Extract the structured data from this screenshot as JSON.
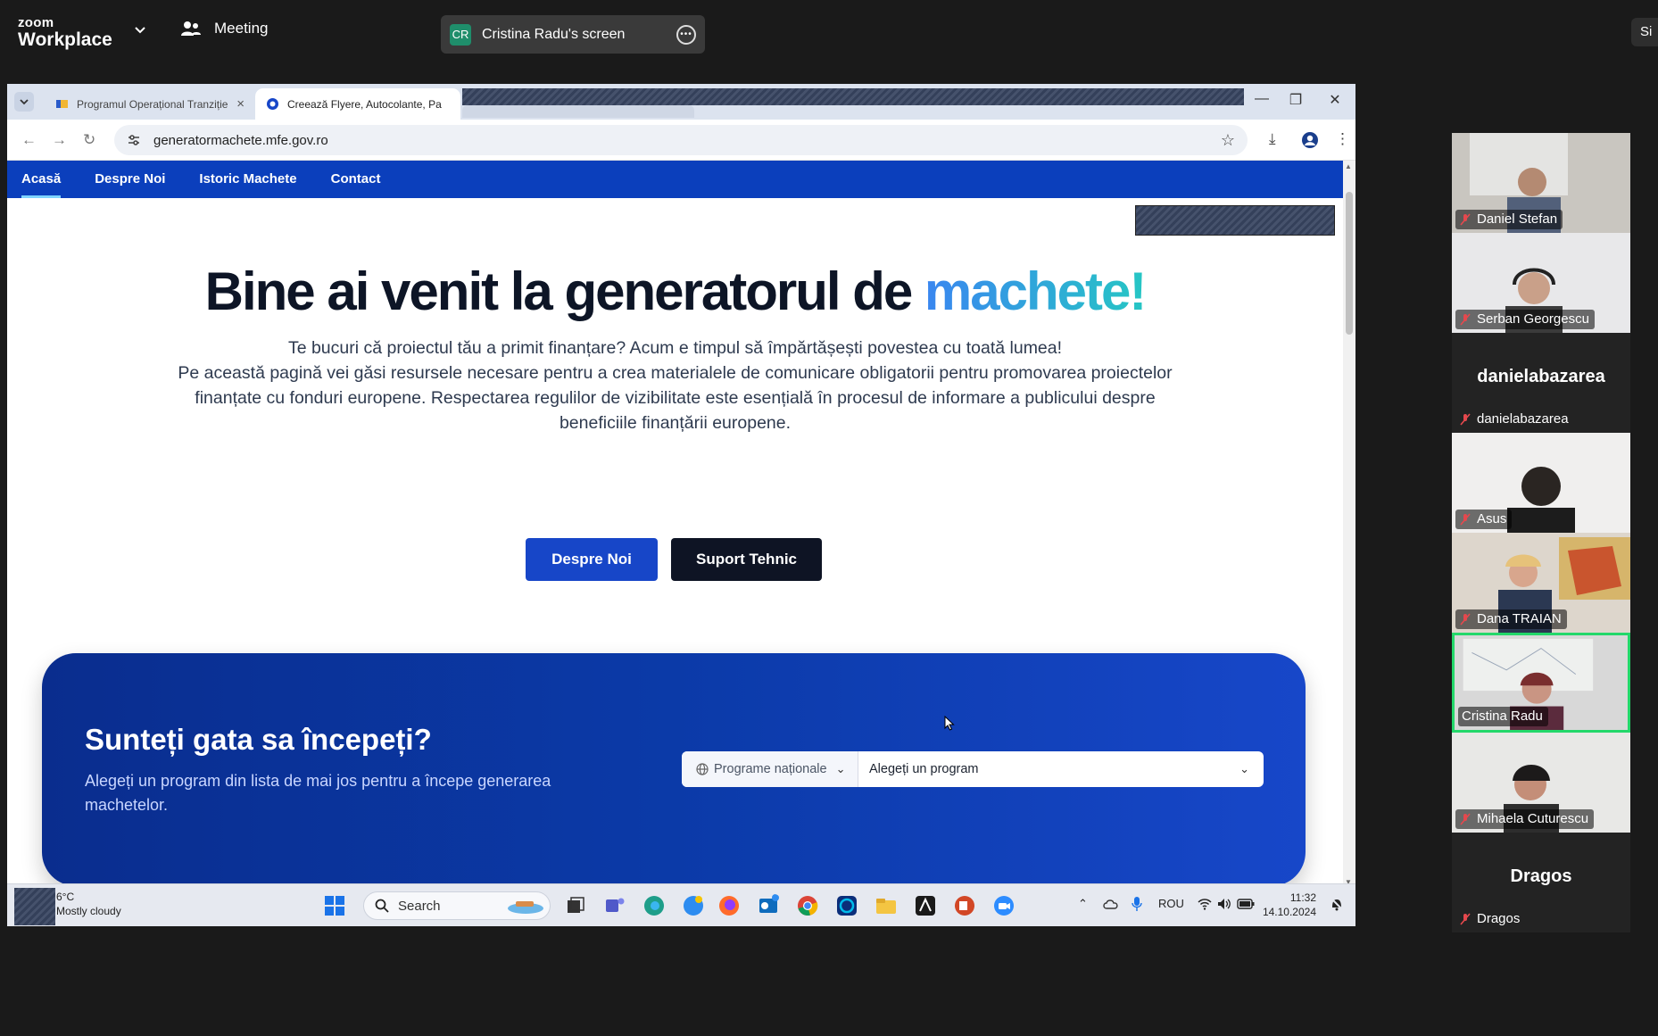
{
  "zoom": {
    "brand_small": "zoom",
    "brand_big": "Workplace",
    "meeting_label": "Meeting",
    "share_initials": "CR",
    "share_label": "Cristina Radu's screen",
    "right_button_label": "Si"
  },
  "browser": {
    "tabs": [
      {
        "label": "Programul Operațional Tranziție"
      },
      {
        "label": "Creează Flyere, Autocolante, Pa"
      }
    ],
    "url": "generatormachete.mfe.gov.ro"
  },
  "site": {
    "nav": [
      "Acasă",
      "Despre Noi",
      "Istoric Machete",
      "Contact"
    ],
    "hero_title_main": "Bine ai venit la generatorul de ",
    "hero_title_accent": "machete!",
    "hero_line1": "Te bucuri că proiectul tău a primit finanțare? Acum e timpul să împărtășești povestea cu toată lumea!",
    "hero_line2": "Pe această pagină vei găsi resursele necesare pentru a crea materialele de comunicare obligatorii pentru promovarea proiectelor finanțate cu fonduri europene. Respectarea regulilor de vizibilitate este esențială în procesul de informare a publicului despre beneficiile finanțării europene.",
    "btn_about": "Despre Noi",
    "btn_support": "Suport Tehnic",
    "cta_title": "Sunteți gata sa începeți?",
    "cta_sub": "Alegeți un program din lista de mai jos pentru a începe generarea machetelor.",
    "select_category": "Programe naționale",
    "select_program": "Alegeți un program"
  },
  "taskbar": {
    "temp": "6°C",
    "weather": "Mostly cloudy",
    "search": "Search",
    "lang": "ROU",
    "time": "11:32",
    "date": "14.10.2024"
  },
  "participants": [
    {
      "name": "Daniel Stefan",
      "video": true
    },
    {
      "name": "Serban Georgescu",
      "video": true
    },
    {
      "name": "danielabazarea",
      "video": false
    },
    {
      "name": "Asus",
      "video": true
    },
    {
      "name": "Dana TRAIAN",
      "video": true
    },
    {
      "name": "Cristina Radu",
      "video": true
    },
    {
      "name": "Mihaela Cuturescu",
      "video": true
    },
    {
      "name": "Dragos",
      "video": false
    }
  ],
  "colors": {
    "site_nav": "#0b3fbc",
    "accent_gradient_start": "#3a86f0",
    "accent_gradient_end": "#26c6c4",
    "cta_bg": "#0b3aa8",
    "active_speaker": "#23d86a"
  }
}
